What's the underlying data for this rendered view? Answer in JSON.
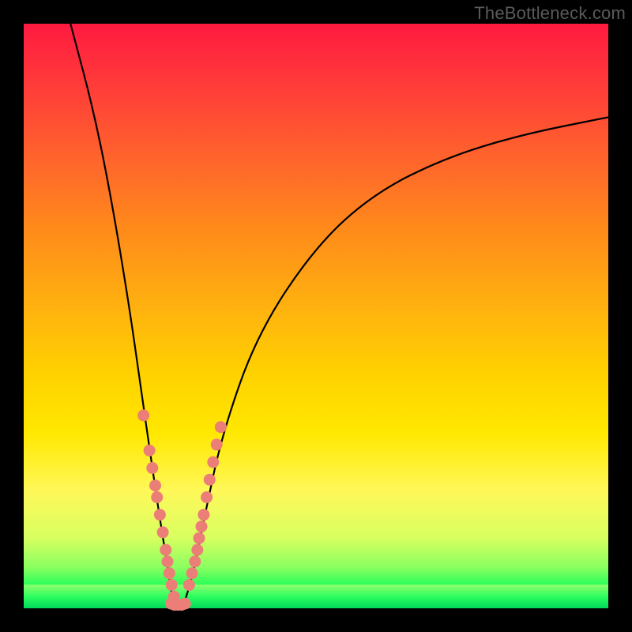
{
  "watermark": {
    "text": "TheBottleneck.com"
  },
  "colors": {
    "frame": "#000000",
    "curve": "#000000",
    "marker_fill": "#ec7e78",
    "marker_stroke": "#c55a54",
    "gradient_top": "#ff1a40",
    "gradient_bottom": "#00e060"
  },
  "chart_data": {
    "type": "line",
    "title": "",
    "xlabel": "",
    "ylabel": "",
    "xlim": [
      0,
      100
    ],
    "ylim": [
      0,
      100
    ],
    "grid": false,
    "legend": false,
    "series": [
      {
        "name": "left-branch",
        "x": [
          8,
          12,
          15,
          18,
          20,
          22,
          23.5,
          24.8,
          25.5
        ],
        "y": [
          100,
          85,
          70,
          52,
          38,
          24,
          14,
          6,
          1
        ]
      },
      {
        "name": "right-branch",
        "x": [
          27.5,
          29,
          31,
          34,
          40,
          50,
          60,
          72,
          85,
          100
        ],
        "y": [
          1,
          6,
          16,
          30,
          47,
          62,
          71,
          77,
          81,
          84
        ]
      },
      {
        "name": "markers-left",
        "type": "scatter",
        "x": [
          20.5,
          21.5,
          22.0,
          22.5,
          22.8,
          23.3,
          23.8,
          24.3,
          24.6,
          24.9,
          25.3,
          25.7
        ],
        "y": [
          33,
          27,
          24,
          21,
          19,
          16,
          13,
          10,
          8,
          6,
          4,
          2
        ]
      },
      {
        "name": "markers-bottom",
        "type": "scatter",
        "x": [
          25.2,
          25.8,
          26.4,
          27.0,
          27.6
        ],
        "y": [
          0.8,
          0.6,
          0.6,
          0.6,
          0.8
        ]
      },
      {
        "name": "markers-right",
        "type": "scatter",
        "x": [
          28.3,
          28.8,
          29.3,
          29.7,
          30.0,
          30.4,
          30.8,
          31.3,
          31.8,
          32.4,
          33.0,
          33.7
        ],
        "y": [
          4,
          6,
          8,
          10,
          12,
          14,
          16,
          19,
          22,
          25,
          28,
          31
        ]
      }
    ]
  }
}
